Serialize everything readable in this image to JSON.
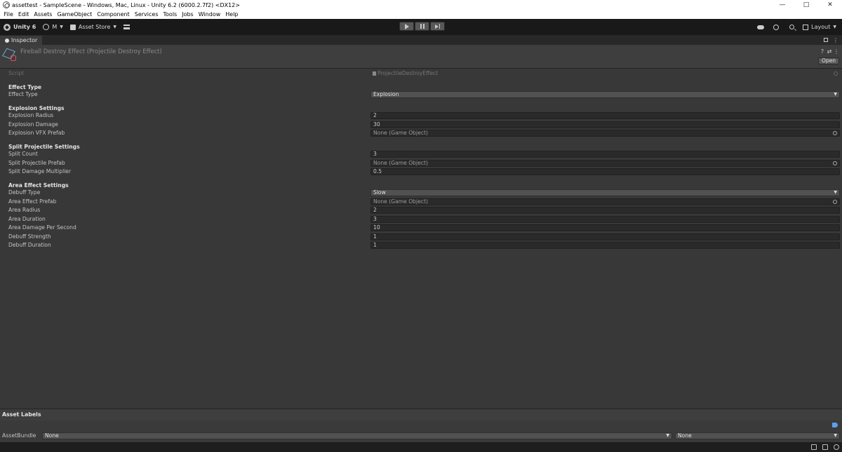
{
  "window": {
    "title": "assettest - SampleScene - Windows, Mac, Linux - Unity 6.2 (6000.2.7f2) <DX12>",
    "controls": [
      "—",
      "□",
      "✕"
    ]
  },
  "menu": [
    "File",
    "Edit",
    "Assets",
    "GameObject",
    "Component",
    "Services",
    "Tools",
    "Jobs",
    "Window",
    "Help"
  ],
  "toolbar": {
    "unity_label": "Unity 6",
    "account_label": "M",
    "asset_store_label": "Asset Store",
    "layout_label": "Layout"
  },
  "inspector": {
    "tab_label": "Inspector",
    "tab_more": "⋮",
    "object_title": "Fireball Destroy Effect (Projectile Destroy Effect)",
    "header_icons": [
      "?",
      "⇄",
      "⋮"
    ],
    "open_label": "Open",
    "script_label": "Script",
    "script_value": "ProjectileDestroyEffect"
  },
  "sections": {
    "effect_type": {
      "header": "Effect Type",
      "label": "Effect Type",
      "value": "Explosion"
    },
    "explosion": {
      "header": "Explosion Settings",
      "radius_label": "Explosion Radius",
      "radius_value": "2",
      "damage_label": "Explosion Damage",
      "damage_value": "30",
      "vfx_label": "Explosion VFX Prefab",
      "vfx_value": "None (Game Object)"
    },
    "split": {
      "header": "Split Projectile Settings",
      "count_label": "Split Count",
      "count_value": "3",
      "prefab_label": "Split Projectile Prefab",
      "prefab_value": "None (Game Object)",
      "multiplier_label": "Split Damage Multiplier",
      "multiplier_value": "0.5"
    },
    "area": {
      "header": "Area Effect Settings",
      "debuff_type_label": "Debuff Type",
      "debuff_type_value": "Slow",
      "prefab_label": "Area Effect Prefab",
      "prefab_value": "None (Game Object)",
      "radius_label": "Area Radius",
      "radius_value": "2",
      "duration_label": "Area Duration",
      "duration_value": "3",
      "dps_label": "Area Damage Per Second",
      "dps_value": "10",
      "strength_label": "Debuff Strength",
      "strength_value": "1",
      "debuff_duration_label": "Debuff Duration",
      "debuff_duration_value": "1"
    }
  },
  "asset_labels": {
    "title": "Asset Labels",
    "bundle_label": "AssetBundle",
    "bundle_value": "None",
    "variant_value": "None"
  },
  "icons": {
    "dropdown": "▼"
  }
}
